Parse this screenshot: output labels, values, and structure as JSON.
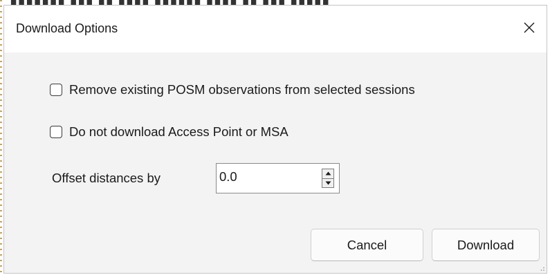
{
  "dialog": {
    "title": "Download Options",
    "close_label": "×"
  },
  "options": {
    "remove_existing": {
      "label": "Remove existing POSM observations from selected sessions",
      "checked": false
    },
    "no_access_point": {
      "label": "Do not download Access Point or MSA",
      "checked": false
    }
  },
  "offset": {
    "label": "Offset distances by",
    "value": "0.0"
  },
  "buttons": {
    "cancel": "Cancel",
    "download": "Download"
  },
  "icons": {
    "close": "close-icon",
    "spin_up": "caret-up-icon",
    "spin_down": "caret-down-icon",
    "resize": "resize-grip-icon"
  }
}
